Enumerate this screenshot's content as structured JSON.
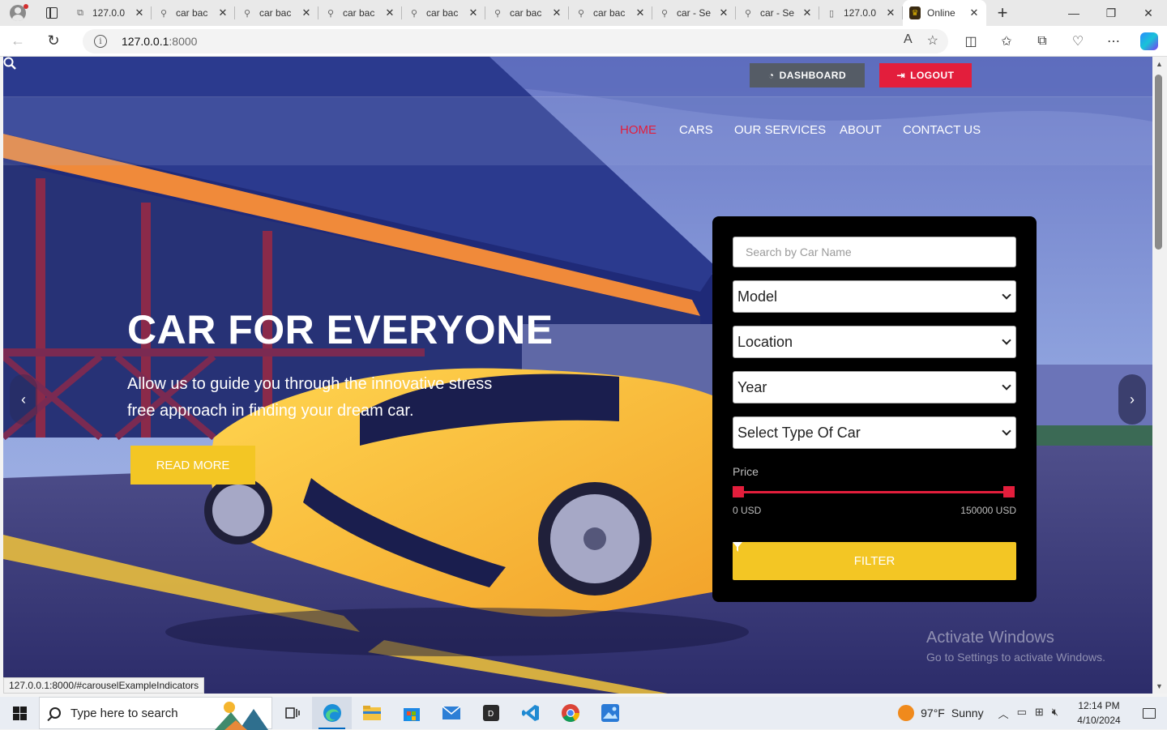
{
  "browser": {
    "tabs": [
      {
        "title": "127.0.0",
        "icon": "page-icon"
      },
      {
        "title": "car bac",
        "icon": "search-icon"
      },
      {
        "title": "car bac",
        "icon": "search-icon"
      },
      {
        "title": "car bac",
        "icon": "search-icon"
      },
      {
        "title": "car bac",
        "icon": "search-icon"
      },
      {
        "title": "car bac",
        "icon": "search-icon"
      },
      {
        "title": "car bac",
        "icon": "search-icon"
      },
      {
        "title": "car - Se",
        "icon": "search-icon"
      },
      {
        "title": "car - Se",
        "icon": "search-icon"
      },
      {
        "title": "127.0.0",
        "icon": "page-icon"
      },
      {
        "title": "Online",
        "icon": "site-favicon",
        "active": true
      }
    ],
    "url_host": "127.0.0.1",
    "url_port": ":8000",
    "status_url": "127.0.0.1:8000/#carouselExampleIndicators"
  },
  "header": {
    "dashboard_label": "DASHBOARD",
    "logout_label": "LOGOUT",
    "nav": [
      "HOME",
      "CARS",
      "OUR SERVICES",
      "ABOUT",
      "CONTACT US"
    ],
    "active_nav": "HOME"
  },
  "hero": {
    "title": "CAR FOR EVERYONE",
    "subtitle": "Allow us to guide you through the innovative stress free approach in finding your dream car.",
    "cta_label": "READ MORE"
  },
  "filter": {
    "search_placeholder": "Search by Car Name",
    "model": "Model",
    "location": "Location",
    "year": "Year",
    "type": "Select Type Of Car",
    "price_label": "Price",
    "price_min": "0 USD",
    "price_max": "150000 USD",
    "filter_label": "FILTER"
  },
  "watermark": {
    "line1": "Activate Windows",
    "line2": "Go to Settings to activate Windows."
  },
  "taskbar": {
    "search_placeholder": "Type here to search",
    "weather_temp": "97°F",
    "weather_text": "Sunny",
    "time": "12:14 PM",
    "date": "4/10/2024"
  },
  "colors": {
    "accent_red": "#e31e3c",
    "accent_yellow": "#f3c624"
  }
}
